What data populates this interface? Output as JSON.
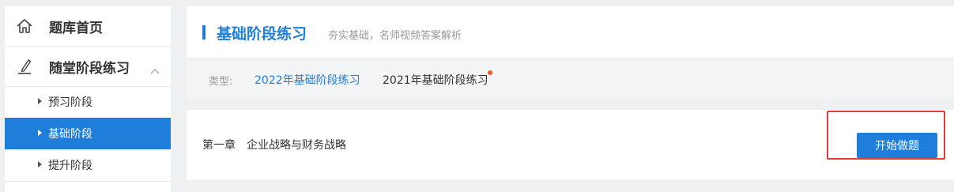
{
  "sidebar": {
    "home": {
      "label": "题库首页",
      "icon": "home-icon"
    },
    "practice": {
      "label": "随堂阶段练习",
      "icon": "edit-pen-icon",
      "expanded": true
    },
    "subitems": [
      {
        "label": "预习阶段",
        "active": false
      },
      {
        "label": "基础阶段",
        "active": true
      },
      {
        "label": "提升阶段",
        "active": false
      }
    ]
  },
  "header": {
    "title": "基础阶段练习",
    "subtitle": "夯实基础，名师视频答案解析"
  },
  "filter": {
    "label": "类型:",
    "options": [
      {
        "label": "2022年基础阶段练习",
        "selected": true
      },
      {
        "label": "2021年基础阶段练习",
        "selected": false,
        "has_dot": true
      }
    ]
  },
  "chapter": {
    "name": "第一章　企业战略与财务战略",
    "button": "开始做题"
  },
  "colors": {
    "accent": "#1e7ed9",
    "highlight_border": "#e63a3a",
    "notify_dot": "#f0582a"
  }
}
